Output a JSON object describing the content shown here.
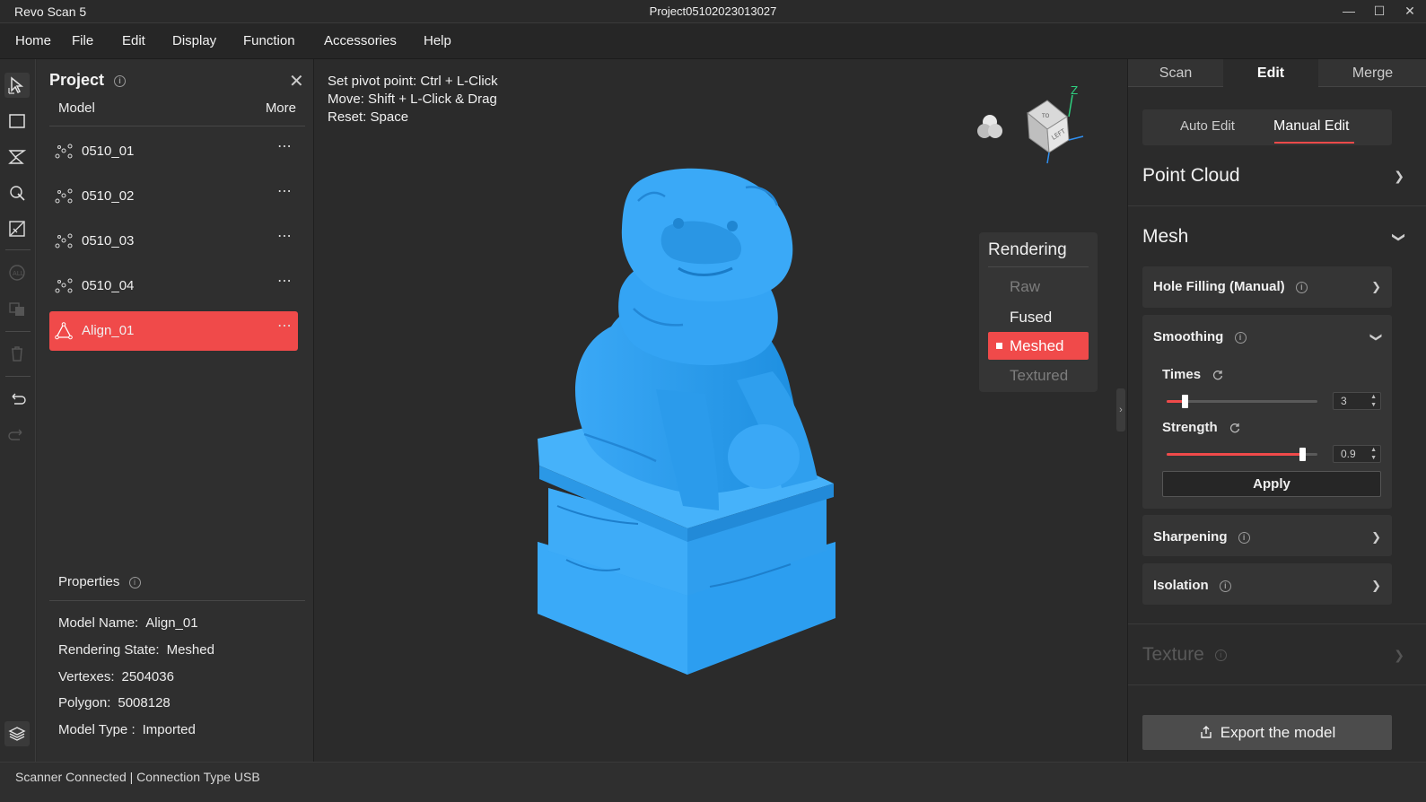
{
  "window": {
    "app_name": "Revo Scan 5",
    "project_title": "Project05102023013027"
  },
  "menu": [
    "Home",
    "File",
    "Edit",
    "Display",
    "Function",
    "Accessories",
    "Help"
  ],
  "project": {
    "title": "Project",
    "col_model": "Model",
    "col_more": "More",
    "models": [
      {
        "name": "0510_01",
        "icon": "point-cloud-icon",
        "selected": false
      },
      {
        "name": "0510_02",
        "icon": "point-cloud-icon",
        "selected": false
      },
      {
        "name": "0510_03",
        "icon": "point-cloud-icon",
        "selected": false
      },
      {
        "name": "0510_04",
        "icon": "point-cloud-icon",
        "selected": false
      },
      {
        "name": "Align_01",
        "icon": "mesh-icon",
        "selected": true
      }
    ],
    "properties": {
      "title": "Properties",
      "items": [
        {
          "key": "Model Name:",
          "value": "Align_01"
        },
        {
          "key": "Rendering State:",
          "value": "Meshed"
        },
        {
          "key": "Vertexes:",
          "value": "2504036"
        },
        {
          "key": "Polygon:",
          "value": "5008128"
        },
        {
          "key": "Model Type :",
          "value": "Imported"
        }
      ]
    }
  },
  "viewport": {
    "hints": [
      "Set pivot point: Ctrl + L-Click",
      "Move: Shift + L-Click & Drag",
      "Reset: Space"
    ],
    "model_color": "#2fa0f0",
    "view_cube": {
      "face_label": "LEFT",
      "top_label": "TO",
      "axis_label": "Z"
    },
    "rendering": {
      "title": "Rendering",
      "options": [
        {
          "label": "Raw",
          "state": "disabled"
        },
        {
          "label": "Fused",
          "state": "enabled"
        },
        {
          "label": "Meshed",
          "state": "selected"
        },
        {
          "label": "Textured",
          "state": "disabled"
        }
      ]
    }
  },
  "right_panel": {
    "tabs": [
      "Scan",
      "Edit",
      "Merge"
    ],
    "active_tab": "Edit",
    "subtabs": [
      "Auto Edit",
      "Manual Edit"
    ],
    "active_subtab": "Manual Edit",
    "point_cloud": "Point Cloud",
    "mesh": "Mesh",
    "hole_filling": "Hole Filling (Manual)",
    "smoothing": {
      "title": "Smoothing",
      "times_label": "Times",
      "times_value": "3",
      "times_fraction": 0.12,
      "strength_label": "Strength",
      "strength_value": "0.9",
      "strength_fraction": 0.9,
      "apply": "Apply"
    },
    "sharpening": "Sharpening",
    "isolation": "Isolation",
    "texture": "Texture",
    "export": "Export the model"
  },
  "status": "Scanner Connected | Connection Type USB",
  "colors": {
    "accent": "#f04a4a",
    "background": "#2b2b2b"
  }
}
